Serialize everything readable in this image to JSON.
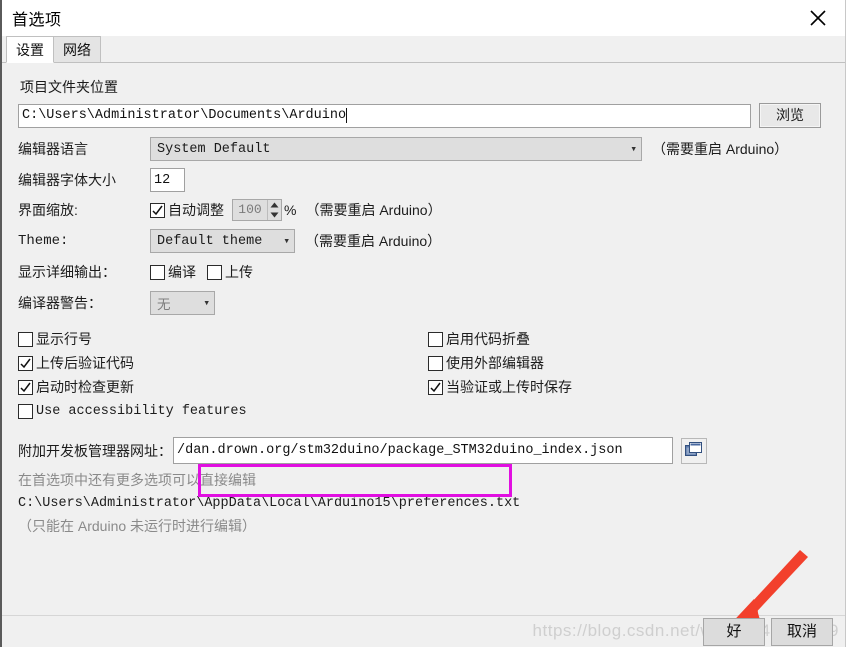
{
  "window": {
    "title": "首选项",
    "close_icon": "close-icon"
  },
  "tabs": [
    {
      "label": "设置",
      "active": true
    },
    {
      "label": "网络",
      "active": false
    }
  ],
  "sketchbook": {
    "label": "项目文件夹位置",
    "value": "C:\\Users\\Administrator\\Documents\\Arduino",
    "browse_label": "浏览"
  },
  "language": {
    "label": "编辑器语言",
    "value": "System Default",
    "note": "（需要重启 Arduino）"
  },
  "font_size": {
    "label": "编辑器字体大小",
    "value": "12"
  },
  "scale": {
    "label": "界面缩放:",
    "auto_label": "自动调整",
    "auto_checked": true,
    "value": "100",
    "percent": "%",
    "note": "（需要重启 Arduino）"
  },
  "theme": {
    "label": "Theme:",
    "value": "Default theme",
    "note": "（需要重启 Arduino）"
  },
  "verbose": {
    "label": "显示详细输出：",
    "compile_label": "编译",
    "compile_checked": false,
    "upload_label": "上传",
    "upload_checked": false
  },
  "warnings": {
    "label": "编译器警告：",
    "value": "无"
  },
  "checkboxes_left": [
    {
      "label": "显示行号",
      "checked": false
    },
    {
      "label": "上传后验证代码",
      "checked": true
    },
    {
      "label": "启动时检查更新",
      "checked": true
    },
    {
      "label": "Use accessibility features",
      "checked": false,
      "mono": true
    }
  ],
  "checkboxes_right": [
    {
      "label": "启用代码折叠",
      "checked": false
    },
    {
      "label": "使用外部编辑器",
      "checked": false
    },
    {
      "label": "当验证或上传时保存",
      "checked": true
    }
  ],
  "boards_url": {
    "label": "附加开发板管理器网址：",
    "value": "/dan.drown.org/stm32duino/package_STM32duino_index.json",
    "icon": "window-stack-icon",
    "highlight_color": "#e10fe1"
  },
  "more_prefs": {
    "hint": "在首选项中还有更多选项可以直接编辑",
    "path": "C:\\Users\\Administrator\\AppData\\Local\\Arduino15\\preferences.txt",
    "note": "（只能在 Arduino 未运行时进行编辑）"
  },
  "footer": {
    "ok_label": "好",
    "cancel_label": "取消",
    "watermark": "https://blog.csdn.net/weixin_47811449",
    "arrow_color": "#f2402c"
  }
}
